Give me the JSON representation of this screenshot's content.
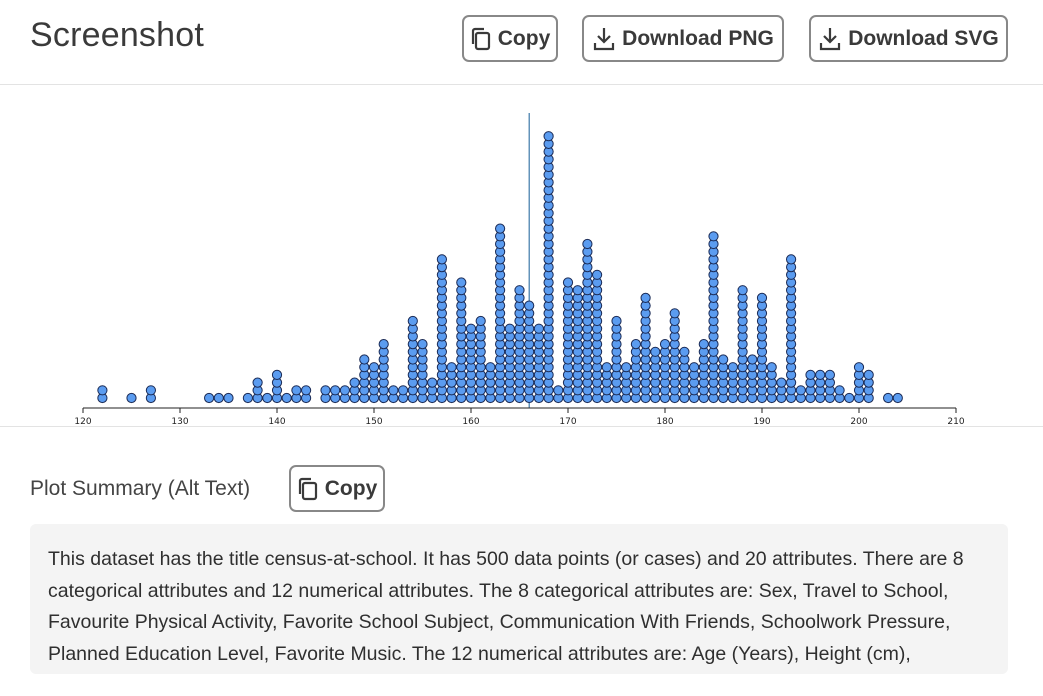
{
  "header": {
    "title": "Screenshot",
    "copy_label": "Copy",
    "download_png_label": "Download PNG",
    "download_svg_label": "Download SVG"
  },
  "icons": {
    "copy": "copy-icon",
    "download": "download-icon"
  },
  "colors": {
    "dot_fill": "#5b9cf0",
    "dot_stroke": "#1a2a55",
    "mean_line": "#3c78a8",
    "axis": "#222222"
  },
  "chart_data": {
    "type": "scatter",
    "subtype": "dot plot",
    "title": "",
    "xlabel": "",
    "ylabel": "",
    "xlim": [
      120,
      210
    ],
    "x_ticks": [
      "120",
      "130",
      "140",
      "150",
      "160",
      "170",
      "180",
      "190",
      "200",
      "210"
    ],
    "reference_line_x": 166,
    "grid": false,
    "points_per_value": [
      {
        "x": 122,
        "count": 2
      },
      {
        "x": 125,
        "count": 1
      },
      {
        "x": 127,
        "count": 2
      },
      {
        "x": 133,
        "count": 1
      },
      {
        "x": 134,
        "count": 1
      },
      {
        "x": 135,
        "count": 1
      },
      {
        "x": 137,
        "count": 1
      },
      {
        "x": 138,
        "count": 3
      },
      {
        "x": 139,
        "count": 1
      },
      {
        "x": 140,
        "count": 4
      },
      {
        "x": 141,
        "count": 1
      },
      {
        "x": 142,
        "count": 2
      },
      {
        "x": 143,
        "count": 2
      },
      {
        "x": 145,
        "count": 2
      },
      {
        "x": 146,
        "count": 2
      },
      {
        "x": 147,
        "count": 2
      },
      {
        "x": 148,
        "count": 3
      },
      {
        "x": 149,
        "count": 6
      },
      {
        "x": 150,
        "count": 5
      },
      {
        "x": 151,
        "count": 8
      },
      {
        "x": 152,
        "count": 2
      },
      {
        "x": 153,
        "count": 2
      },
      {
        "x": 154,
        "count": 11
      },
      {
        "x": 155,
        "count": 8
      },
      {
        "x": 156,
        "count": 3
      },
      {
        "x": 157,
        "count": 19
      },
      {
        "x": 158,
        "count": 5
      },
      {
        "x": 159,
        "count": 16
      },
      {
        "x": 160,
        "count": 10
      },
      {
        "x": 161,
        "count": 11
      },
      {
        "x": 162,
        "count": 5
      },
      {
        "x": 163,
        "count": 23
      },
      {
        "x": 164,
        "count": 10
      },
      {
        "x": 165,
        "count": 15
      },
      {
        "x": 166,
        "count": 13
      },
      {
        "x": 167,
        "count": 10
      },
      {
        "x": 168,
        "count": 35
      },
      {
        "x": 169,
        "count": 2
      },
      {
        "x": 170,
        "count": 16
      },
      {
        "x": 171,
        "count": 15
      },
      {
        "x": 172,
        "count": 21
      },
      {
        "x": 173,
        "count": 17
      },
      {
        "x": 174,
        "count": 5
      },
      {
        "x": 175,
        "count": 11
      },
      {
        "x": 176,
        "count": 5
      },
      {
        "x": 177,
        "count": 8
      },
      {
        "x": 178,
        "count": 14
      },
      {
        "x": 179,
        "count": 7
      },
      {
        "x": 180,
        "count": 8
      },
      {
        "x": 181,
        "count": 12
      },
      {
        "x": 182,
        "count": 7
      },
      {
        "x": 183,
        "count": 5
      },
      {
        "x": 184,
        "count": 8
      },
      {
        "x": 185,
        "count": 22
      },
      {
        "x": 186,
        "count": 6
      },
      {
        "x": 187,
        "count": 5
      },
      {
        "x": 188,
        "count": 15
      },
      {
        "x": 189,
        "count": 6
      },
      {
        "x": 190,
        "count": 14
      },
      {
        "x": 191,
        "count": 5
      },
      {
        "x": 192,
        "count": 3
      },
      {
        "x": 193,
        "count": 19
      },
      {
        "x": 194,
        "count": 2
      },
      {
        "x": 195,
        "count": 4
      },
      {
        "x": 196,
        "count": 4
      },
      {
        "x": 197,
        "count": 4
      },
      {
        "x": 198,
        "count": 2
      },
      {
        "x": 199,
        "count": 1
      },
      {
        "x": 200,
        "count": 5
      },
      {
        "x": 201,
        "count": 4
      },
      {
        "x": 204,
        "count": 1
      },
      {
        "x": 203,
        "count": 1
      }
    ]
  },
  "summary": {
    "label": "Plot Summary (Alt Text)",
    "copy_label": "Copy",
    "text": "This dataset has the title census-at-school. It has 500 data points (or cases) and 20 attributes. There are 8 categorical attributes and 12 numerical attributes. The 8 categorical attributes are: Sex, Travel to School, Favourite Physical Activity, Favorite School Subject, Communication With Friends, Schoolwork Pressure, Planned Education Level, Favorite Music. The 12 numerical attributes are: Age (Years), Height (cm),"
  }
}
